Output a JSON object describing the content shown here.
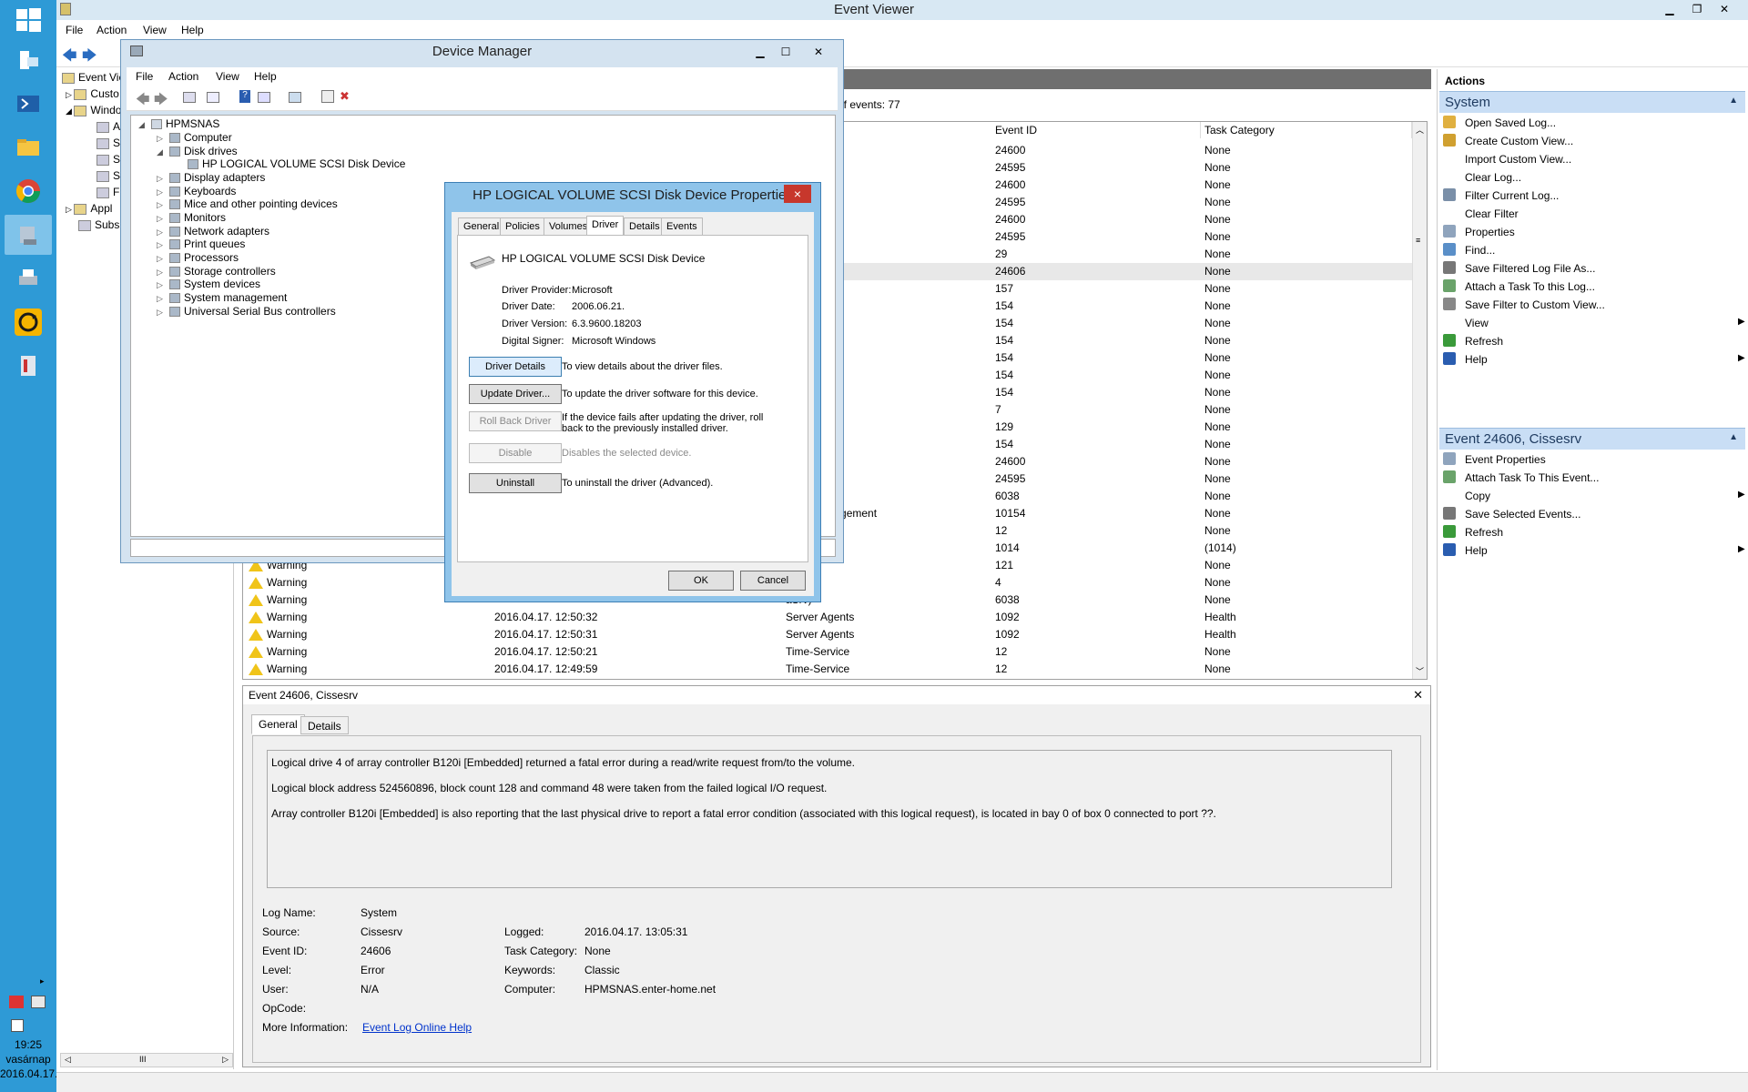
{
  "taskbar": {
    "time": "19:25",
    "day": "vasárnap",
    "date": "2016.04.17."
  },
  "event_viewer": {
    "title": "Event Viewer",
    "menu": [
      "File",
      "Action",
      "View",
      "Help"
    ],
    "tree": [
      "Event Vie",
      "Custo",
      "Windo",
      "A",
      "S",
      "S",
      "S",
      "F",
      "Appl",
      "Subs"
    ],
    "events_count": "of events: 77",
    "columns": [
      "Event ID",
      "Task Category"
    ],
    "rows": [
      {
        "level": "",
        "date": "",
        "source": "",
        "id": "24600",
        "cat": "None"
      },
      {
        "level": "",
        "date": "",
        "source": "",
        "id": "24595",
        "cat": "None"
      },
      {
        "level": "",
        "date": "",
        "source": "",
        "id": "24600",
        "cat": "None"
      },
      {
        "level": "",
        "date": "",
        "source": "",
        "id": "24595",
        "cat": "None"
      },
      {
        "level": "",
        "date": "",
        "source": "",
        "id": "24600",
        "cat": "None"
      },
      {
        "level": "",
        "date": "",
        "source": "",
        "id": "24595",
        "cat": "None"
      },
      {
        "level": "",
        "date": "",
        "source": "c Provider",
        "id": "29",
        "cat": "None"
      },
      {
        "level": "",
        "date": "",
        "source": "",
        "id": "24606",
        "cat": "None"
      },
      {
        "level": "",
        "date": "",
        "source": "",
        "id": "157",
        "cat": "None"
      },
      {
        "level": "",
        "date": "",
        "source": "",
        "id": "154",
        "cat": "None"
      },
      {
        "level": "",
        "date": "",
        "source": "",
        "id": "154",
        "cat": "None"
      },
      {
        "level": "",
        "date": "",
        "source": "",
        "id": "154",
        "cat": "None"
      },
      {
        "level": "",
        "date": "",
        "source": "",
        "id": "154",
        "cat": "None"
      },
      {
        "level": "",
        "date": "",
        "source": "",
        "id": "154",
        "cat": "None"
      },
      {
        "level": "",
        "date": "",
        "source": "",
        "id": "154",
        "cat": "None"
      },
      {
        "level": "",
        "date": "",
        "source": "",
        "id": "7",
        "cat": "None"
      },
      {
        "level": "",
        "date": "",
        "source": "",
        "id": "129",
        "cat": "None"
      },
      {
        "level": "",
        "date": "",
        "source": "",
        "id": "154",
        "cat": "None"
      },
      {
        "level": "",
        "date": "",
        "source": "",
        "id": "24600",
        "cat": "None"
      },
      {
        "level": "",
        "date": "",
        "source": "",
        "id": "24595",
        "cat": "None"
      },
      {
        "level": "",
        "date": "",
        "source": "",
        "id": "6038",
        "cat": "None"
      },
      {
        "level": "",
        "date": "",
        "source": "mote Management",
        "id": "10154",
        "cat": "None"
      },
      {
        "level": "",
        "date": "",
        "source": "e",
        "id": "12",
        "cat": "None"
      },
      {
        "level": "",
        "date": "",
        "source": "vents",
        "id": "1014",
        "cat": "(1014)"
      },
      {
        "level": "Warning",
        "date": "",
        "source": "",
        "id": "121",
        "cat": "None"
      },
      {
        "level": "Warning",
        "date": "",
        "source": "0a",
        "id": "4",
        "cat": "None"
      },
      {
        "level": "Warning",
        "date": "",
        "source": "aSrv)",
        "id": "6038",
        "cat": "None"
      },
      {
        "level": "Warning",
        "date": "2016.04.17. 12:50:32",
        "source": "Server Agents",
        "id": "1092",
        "cat": "Health"
      },
      {
        "level": "Warning",
        "date": "2016.04.17. 12:50:31",
        "source": "Server Agents",
        "id": "1092",
        "cat": "Health"
      },
      {
        "level": "Warning",
        "date": "2016.04.17. 12:50:21",
        "source": "Time-Service",
        "id": "12",
        "cat": "None"
      },
      {
        "level": "Warning",
        "date": "2016.04.17. 12:49:59",
        "source": "Time-Service",
        "id": "12",
        "cat": "None"
      }
    ],
    "detail": {
      "title": "Event 24606, Cissesrv",
      "tabs": [
        "General",
        "Details"
      ],
      "desc": [
        "Logical drive 4 of array controller B120i [Embedded] returned a fatal error during a read/write request from/to the volume.",
        "Logical block address 524560896, block count 128 and command 48 were taken from the failed logical I/O request.",
        "Array controller B120i [Embedded] is also reporting that the last physical drive to report a fatal error condition (associated with this logical request), is located  in bay 0 of box 0 connected to port ??."
      ],
      "log_name_label": "Log Name:",
      "log_name": "System",
      "source_label": "Source:",
      "source": "Cissesrv",
      "logged_label": "Logged:",
      "logged": "2016.04.17. 13:05:31",
      "event_id_label": "Event ID:",
      "event_id": "24606",
      "task_cat_label": "Task Category:",
      "task_cat": "None",
      "level_label": "Level:",
      "level": "Error",
      "keywords_label": "Keywords:",
      "keywords": "Classic",
      "user_label": "User:",
      "user": "N/A",
      "computer_label": "Computer:",
      "computer": "HPMSNAS.enter-home.net",
      "opcode_label": "OpCode:",
      "more_info_label": "More Information:",
      "more_info_link": "Event Log Online Help"
    },
    "actions": {
      "header": "Actions",
      "group1": "System",
      "items1": [
        "Open Saved Log...",
        "Create Custom View...",
        "Import Custom View...",
        "Clear Log...",
        "Filter Current Log...",
        "Clear Filter",
        "Properties",
        "Find...",
        "Save Filtered Log File As...",
        "Attach a Task To this Log...",
        "Save Filter to Custom View...",
        "View",
        "Refresh",
        "Help"
      ],
      "group2": "Event 24606, Cissesrv",
      "items2": [
        "Event Properties",
        "Attach Task To This Event...",
        "Copy",
        "Save Selected Events...",
        "Refresh",
        "Help"
      ]
    }
  },
  "device_manager": {
    "title": "Device Manager",
    "menu": [
      "File",
      "Action",
      "View",
      "Help"
    ],
    "tree": [
      "HPMSNAS",
      "Computer",
      "Disk drives",
      "HP LOGICAL VOLUME SCSI Disk Device",
      "Display adapters",
      "Keyboards",
      "Mice and other pointing devices",
      "Monitors",
      "Network adapters",
      "Print queues",
      "Processors",
      "Storage controllers",
      "System devices",
      "System management",
      "Universal Serial Bus controllers"
    ]
  },
  "properties": {
    "title": "HP LOGICAL VOLUME SCSI Disk Device Properties",
    "close": "×",
    "tabs": [
      "General",
      "Policies",
      "Volumes",
      "Driver",
      "Details",
      "Events"
    ],
    "device_name": "HP LOGICAL VOLUME SCSI Disk Device",
    "provider_label": "Driver Provider:",
    "provider": "Microsoft",
    "date_label": "Driver Date:",
    "date": "2006.06.21.",
    "version_label": "Driver Version:",
    "version": "6.3.9600.18203",
    "signer_label": "Digital Signer:",
    "signer": "Microsoft Windows",
    "btn_details": "Driver Details",
    "desc_details": "To view details about the driver files.",
    "btn_update": "Update Driver...",
    "desc_update": "To update the driver software for this device.",
    "btn_rollback": "Roll Back Driver",
    "desc_rollback": "If the device fails after updating the driver, roll back to the previously installed driver.",
    "btn_disable": "Disable",
    "desc_disable": "Disables the selected device.",
    "btn_uninstall": "Uninstall",
    "desc_uninstall": "To uninstall the driver (Advanced).",
    "ok": "OK",
    "cancel": "Cancel"
  }
}
